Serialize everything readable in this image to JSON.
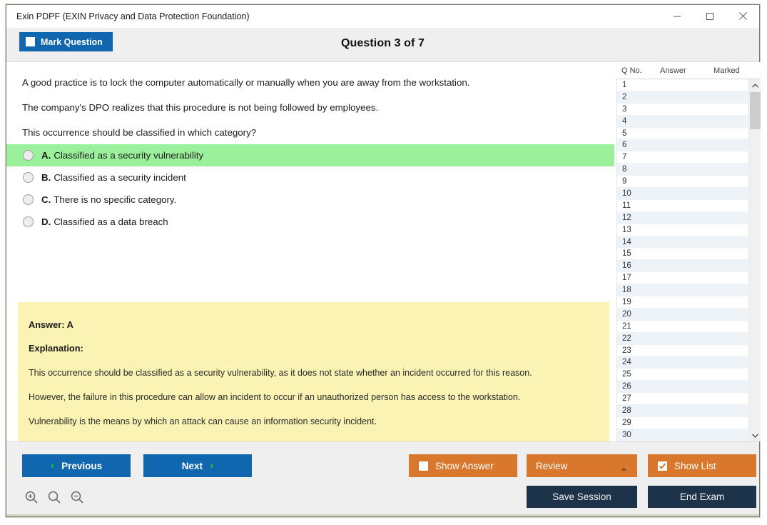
{
  "window": {
    "title": "Exin PDPF (EXIN Privacy and Data Protection Foundation)",
    "controls": {
      "minimize": "minimize-icon",
      "maximize": "maximize-icon",
      "close": "close-icon"
    }
  },
  "header": {
    "mark_question_label": "Mark Question",
    "mark_question_checked": false,
    "question_counter": "Question 3 of 7"
  },
  "question": {
    "lines": [
      "A good practice is to lock the computer automatically or manually when you are away from the workstation.",
      "The company's DPO realizes that this procedure is not being followed by employees.",
      "This occurrence should be classified in which category?"
    ],
    "options": [
      {
        "letter": "A.",
        "text": "Classified as a security vulnerability",
        "correct": true,
        "selected": false
      },
      {
        "letter": "B.",
        "text": "Classified as a security incident",
        "correct": false,
        "selected": false
      },
      {
        "letter": "C.",
        "text": "There is no specific category.",
        "correct": false,
        "selected": false
      },
      {
        "letter": "D.",
        "text": "Classified as a data breach",
        "correct": false,
        "selected": false
      }
    ]
  },
  "answer_box": {
    "answer_label": "Answer: A",
    "explanation_label": "Explanation:",
    "paragraphs": [
      "This occurrence should be classified as a security vulnerability, as it does not state whether an incident occurred for this reason.",
      "However, the failure in this procedure can allow an incident to occur if an unauthorized person has access to the workstation.",
      "Vulnerability is the means by which an attack can cause an information security incident."
    ]
  },
  "list_panel": {
    "columns": [
      "Q No.",
      "Answer",
      "Marked"
    ],
    "rows": [
      {
        "no": "1",
        "answer": "",
        "marked": ""
      },
      {
        "no": "2",
        "answer": "",
        "marked": ""
      },
      {
        "no": "3",
        "answer": "",
        "marked": ""
      },
      {
        "no": "4",
        "answer": "",
        "marked": ""
      },
      {
        "no": "5",
        "answer": "",
        "marked": ""
      },
      {
        "no": "6",
        "answer": "",
        "marked": ""
      },
      {
        "no": "7",
        "answer": "",
        "marked": ""
      },
      {
        "no": "8",
        "answer": "",
        "marked": ""
      },
      {
        "no": "9",
        "answer": "",
        "marked": ""
      },
      {
        "no": "10",
        "answer": "",
        "marked": ""
      },
      {
        "no": "11",
        "answer": "",
        "marked": ""
      },
      {
        "no": "12",
        "answer": "",
        "marked": ""
      },
      {
        "no": "13",
        "answer": "",
        "marked": ""
      },
      {
        "no": "14",
        "answer": "",
        "marked": ""
      },
      {
        "no": "15",
        "answer": "",
        "marked": ""
      },
      {
        "no": "16",
        "answer": "",
        "marked": ""
      },
      {
        "no": "17",
        "answer": "",
        "marked": ""
      },
      {
        "no": "18",
        "answer": "",
        "marked": ""
      },
      {
        "no": "19",
        "answer": "",
        "marked": ""
      },
      {
        "no": "20",
        "answer": "",
        "marked": ""
      },
      {
        "no": "21",
        "answer": "",
        "marked": ""
      },
      {
        "no": "22",
        "answer": "",
        "marked": ""
      },
      {
        "no": "23",
        "answer": "",
        "marked": ""
      },
      {
        "no": "24",
        "answer": "",
        "marked": ""
      },
      {
        "no": "25",
        "answer": "",
        "marked": ""
      },
      {
        "no": "26",
        "answer": "",
        "marked": ""
      },
      {
        "no": "27",
        "answer": "",
        "marked": ""
      },
      {
        "no": "28",
        "answer": "",
        "marked": ""
      },
      {
        "no": "29",
        "answer": "",
        "marked": ""
      },
      {
        "no": "30",
        "answer": "",
        "marked": ""
      }
    ]
  },
  "toolbar": {
    "previous_label": "Previous",
    "next_label": "Next",
    "show_answer_label": "Show Answer",
    "show_answer_checked": false,
    "review_label": "Review",
    "show_list_label": "Show List",
    "show_list_checked": true,
    "save_session_label": "Save Session",
    "end_exam_label": "End Exam",
    "zoom_in_icon": "zoom-in-icon",
    "zoom_reset_icon": "zoom-reset-icon",
    "zoom_out_icon": "zoom-out-icon"
  },
  "colors": {
    "primary_blue": "#1067b0",
    "accent_orange": "#d9782d",
    "dark_navy": "#1d3349",
    "correct_green": "#9bf09b",
    "answer_yellow": "#faf3b4",
    "chevron_green": "#27c12a"
  }
}
